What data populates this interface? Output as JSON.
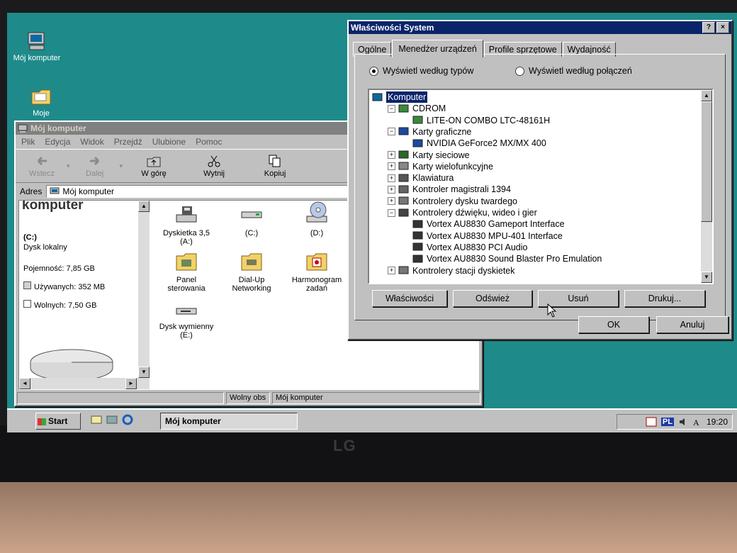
{
  "desktop": {
    "icons": [
      {
        "label": "Mój komputer",
        "icon": "computer-icon"
      },
      {
        "label": "Moje",
        "icon": "folder-icon"
      }
    ]
  },
  "explorer": {
    "title": "Mój komputer",
    "menu": [
      "Plik",
      "Edycja",
      "Widok",
      "Przejdź",
      "Ulubione",
      "Pomoc"
    ],
    "toolbar": [
      {
        "label": "Wstecz",
        "icon": "back-arrow-icon",
        "enabled": false
      },
      {
        "label": "Dalej",
        "icon": "forward-arrow-icon",
        "enabled": false
      },
      {
        "label": "W górę",
        "icon": "up-folder-icon",
        "enabled": true
      },
      {
        "label": "Wytnij",
        "icon": "scissors-icon",
        "enabled": true
      },
      {
        "label": "Kopiuj",
        "icon": "copy-icon",
        "enabled": true
      }
    ],
    "address_label": "Adres",
    "address_value": "Mój komputer",
    "left_pane": {
      "heading": "komputer",
      "drive_name": "(C:)",
      "drive_type": "Dysk lokalny",
      "capacity": "Pojemność: 7,85 GB",
      "used": "Używanych: 352 MB",
      "free": "Wolnych: 7,50 GB"
    },
    "items": [
      {
        "label": "Dyskietka 3,5 (A:)",
        "icon": "floppy-drive-icon"
      },
      {
        "label": "(C:)",
        "icon": "hard-drive-icon"
      },
      {
        "label": "(D:)",
        "icon": "cd-drive-icon"
      },
      {
        "label": "Panel sterowania",
        "icon": "control-panel-folder-icon"
      },
      {
        "label": "Dial-Up Networking",
        "icon": "dialup-folder-icon"
      },
      {
        "label": "Harmonogram zadań",
        "icon": "scheduled-tasks-folder-icon"
      },
      {
        "label": "Dysk wymienny (E:)",
        "icon": "removable-drive-icon"
      }
    ],
    "status": {
      "left": "Wolny obs",
      "right": "Mój komputer"
    }
  },
  "dialog": {
    "title": "Właściwości System",
    "help_button": "?",
    "close_button": "×",
    "tabs": [
      "Ogólne",
      "Menedżer urządzeń",
      "Profile sprzętowe",
      "Wydajność"
    ],
    "selected_tab": 1,
    "radio_by_type": "Wyświetl według typów",
    "radio_by_connection": "Wyświetl według połączeń",
    "tree": [
      {
        "label": "Komputer",
        "level": 0,
        "toggle": "",
        "icon": "computer-icon"
      },
      {
        "label": "CDROM",
        "level": 1,
        "toggle": "−",
        "icon": "cdrom-icon"
      },
      {
        "label": "LITE-ON COMBO LTC-48161H",
        "level": 2,
        "toggle": "",
        "icon": "cdrom-icon"
      },
      {
        "label": "Karty graficzne",
        "level": 1,
        "toggle": "−",
        "icon": "display-icon"
      },
      {
        "label": "NVIDIA GeForce2 MX/MX 400",
        "level": 2,
        "toggle": "",
        "icon": "display-icon"
      },
      {
        "label": "Karty sieciowe",
        "level": 1,
        "toggle": "+",
        "icon": "network-card-icon"
      },
      {
        "label": "Karty wielofunkcyjne",
        "level": 1,
        "toggle": "+",
        "icon": "multifunction-icon"
      },
      {
        "label": "Klawiatura",
        "level": 1,
        "toggle": "+",
        "icon": "keyboard-icon"
      },
      {
        "label": "Kontroler magistrali 1394",
        "level": 1,
        "toggle": "+",
        "icon": "bus-controller-icon"
      },
      {
        "label": "Kontrolery dysku twardego",
        "level": 1,
        "toggle": "+",
        "icon": "disk-controller-icon"
      },
      {
        "label": "Kontrolery dźwięku, wideo i gier",
        "level": 1,
        "toggle": "−",
        "icon": "sound-icon"
      },
      {
        "label": "Vortex AU8830 Gameport Interface",
        "level": 2,
        "toggle": "",
        "icon": "sound-device-icon"
      },
      {
        "label": "Vortex AU8830 MPU-401 Interface",
        "level": 2,
        "toggle": "",
        "icon": "sound-device-icon"
      },
      {
        "label": "Vortex AU8830 PCI Audio",
        "level": 2,
        "toggle": "",
        "icon": "sound-device-icon"
      },
      {
        "label": "Vortex AU8830 Sound Blaster Pro Emulation",
        "level": 2,
        "toggle": "",
        "icon": "sound-device-icon"
      },
      {
        "label": "Kontrolery stacji dyskietek",
        "level": 1,
        "toggle": "+",
        "icon": "floppy-controller-icon"
      }
    ],
    "buttons": {
      "properties": "Właściwości",
      "refresh": "Odśwież",
      "remove": "Usuń",
      "print": "Drukuj..."
    },
    "ok": "OK",
    "cancel": "Anuluj"
  },
  "taskbar": {
    "start": "Start",
    "task": "Mój komputer",
    "clock": "19:20",
    "tray_lang": "PL"
  },
  "monitor_brand": "LG"
}
